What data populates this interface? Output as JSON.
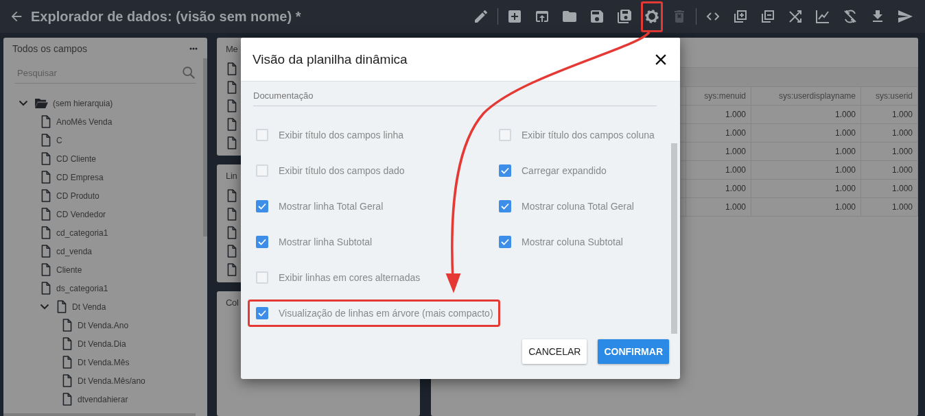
{
  "header": {
    "title": "Explorador de dados: (visão sem nome) *"
  },
  "toolbar": [
    {
      "disabled": false,
      "highlighted": false
    },
    {
      "disabled": false,
      "highlighted": false
    },
    {
      "disabled": false,
      "highlighted": false
    },
    {
      "disabled": false,
      "highlighted": false
    },
    {
      "disabled": false,
      "highlighted": false
    },
    {
      "disabled": false,
      "highlighted": false
    },
    {
      "disabled": false,
      "highlighted": true
    },
    {
      "disabled": true,
      "highlighted": false
    },
    {
      "disabled": false,
      "highlighted": false
    },
    {
      "disabled": false,
      "highlighted": false
    },
    {
      "disabled": false,
      "highlighted": false
    },
    {
      "disabled": false,
      "highlighted": false
    },
    {
      "disabled": false,
      "highlighted": false
    },
    {
      "disabled": false,
      "highlighted": false
    },
    {
      "disabled": false,
      "highlighted": false
    },
    {
      "disabled": false,
      "highlighted": false
    }
  ],
  "fields_panel": {
    "title": "Todos os campos",
    "search": {
      "placeholder": "Pesquisar"
    },
    "tree": [
      {
        "label": "(sem hierarquia)",
        "kind": "folder",
        "expanded": true,
        "children": [
          {
            "label": "AnoMês Venda",
            "kind": "field"
          },
          {
            "label": "C",
            "kind": "field"
          },
          {
            "label": "CD Cliente",
            "kind": "field"
          },
          {
            "label": "CD Empresa",
            "kind": "field"
          },
          {
            "label": "CD Produto",
            "kind": "field"
          },
          {
            "label": "CD Vendedor",
            "kind": "field"
          },
          {
            "label": "cd_categoria1",
            "kind": "field"
          },
          {
            "label": "cd_venda",
            "kind": "field"
          },
          {
            "label": "Cliente",
            "kind": "field"
          },
          {
            "label": "ds_categoria1",
            "kind": "field"
          },
          {
            "label": "Dt Venda",
            "kind": "field",
            "expanded": true,
            "children": [
              {
                "label": "Dt Venda.Ano",
                "kind": "field"
              },
              {
                "label": "Dt Venda.Dia",
                "kind": "field"
              },
              {
                "label": "Dt Venda.Mês",
                "kind": "field"
              },
              {
                "label": "Dt Venda.Mês/ano",
                "kind": "field"
              },
              {
                "label": "dtvendahierar",
                "kind": "field"
              }
            ]
          }
        ]
      }
    ]
  },
  "zone_panels": [
    {
      "title": "Me",
      "kind": "list"
    },
    {
      "title": "Lin",
      "kind": "list"
    },
    {
      "title": "Col",
      "kind": "empty"
    }
  ],
  "table": {
    "columns": [
      "sys:menuid",
      "sys:userdisplayname",
      "sys:userid"
    ],
    "rows": [
      [
        "1.000",
        "1.000",
        "1.000"
      ],
      [
        "1.000",
        "1.000",
        "1.000"
      ],
      [
        "1.000",
        "1.000",
        "1.000"
      ],
      [
        "1.000",
        "1.000",
        "1.000"
      ],
      [
        "1.000",
        "1.000",
        "1.000"
      ],
      [
        "1.000",
        "1.000",
        "1.000"
      ]
    ]
  },
  "dialog": {
    "title": "Visão da planilha dinâmica",
    "section": "Documentação",
    "option_rows": [
      [
        {
          "label": "Exibir título dos campos linha",
          "checked": false,
          "highlighted": false
        },
        {
          "label": "Exibir título dos campos coluna",
          "checked": false,
          "highlighted": false
        }
      ],
      [
        {
          "label": "Exibir título dos campos dado",
          "checked": false,
          "highlighted": false
        },
        {
          "label": "Carregar expandido",
          "checked": true,
          "highlighted": false
        }
      ],
      [
        {
          "label": "Mostrar linha Total Geral",
          "checked": true,
          "highlighted": false
        },
        {
          "label": "Mostrar coluna Total Geral",
          "checked": true,
          "highlighted": false
        }
      ],
      [
        {
          "label": "Mostrar linha Subtotal",
          "checked": true,
          "highlighted": false
        },
        {
          "label": "Mostrar coluna Subtotal",
          "checked": true,
          "highlighted": false
        }
      ],
      [
        {
          "label": "Exibir linhas em cores alternadas",
          "checked": false,
          "highlighted": false
        }
      ],
      [
        {
          "label": "Visualização de linhas em árvore (mais compacto)",
          "checked": true,
          "highlighted": true
        }
      ]
    ],
    "buttons": [
      {
        "label": "CANCELAR",
        "kind": "secondary"
      },
      {
        "label": "CONFIRMAR",
        "kind": "primary"
      }
    ]
  }
}
